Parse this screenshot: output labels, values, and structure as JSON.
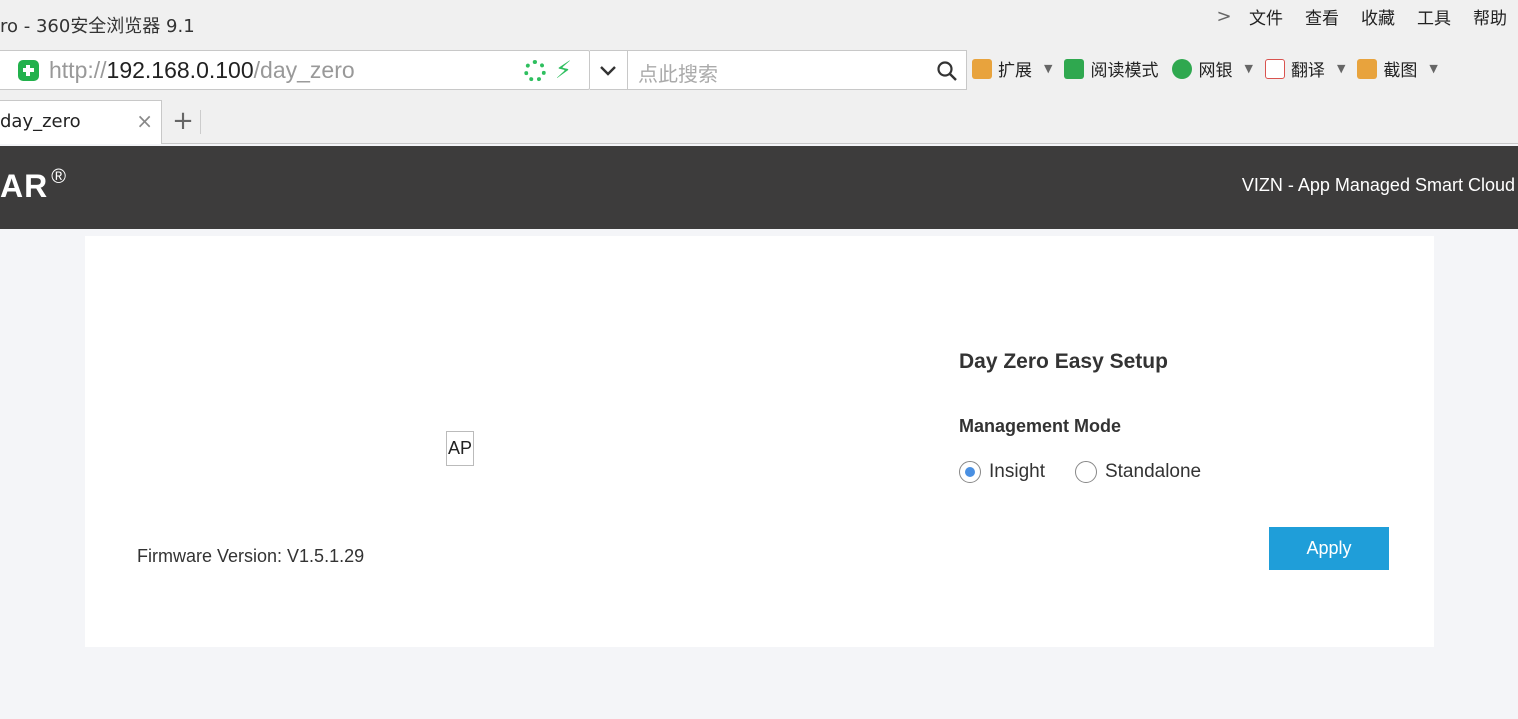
{
  "window": {
    "title": "ro - 360安全浏览器 9.1"
  },
  "menu": {
    "chevron": ">",
    "items": [
      "文件",
      "查看",
      "收藏",
      "工具",
      "帮助"
    ]
  },
  "address_bar": {
    "scheme": "http://",
    "host": "192.168.0.100",
    "path": "/day_zero"
  },
  "search": {
    "placeholder": "点此搜索"
  },
  "extensions": [
    {
      "label": "扩展",
      "icon": "extensions-icon",
      "color": "#e8a33d",
      "has_caret": true
    },
    {
      "label": "阅读模式",
      "icon": "reading-mode-icon",
      "color": "#2fa84f",
      "has_caret": false
    },
    {
      "label": "网银",
      "icon": "netbank-icon",
      "color": "#2fa84f",
      "has_caret": true
    },
    {
      "label": "翻译",
      "icon": "translate-icon",
      "color": "#d9534f",
      "has_caret": true
    },
    {
      "label": "截图",
      "icon": "screenshot-icon",
      "color": "#e8a33d",
      "has_caret": true
    }
  ],
  "tab": {
    "label": "day_zero",
    "close": "×",
    "new_tab": "+"
  },
  "header": {
    "brand": "AR",
    "brand_mark": "®",
    "tagline": "VIZN - App Managed Smart Cloud"
  },
  "card": {
    "device_label": "AP",
    "firmware": "Firmware Version: V1.5.1.29",
    "setup_title": "Day Zero Easy Setup",
    "mode_label": "Management Mode",
    "modes": [
      {
        "label": "Insight",
        "checked": true
      },
      {
        "label": "Standalone",
        "checked": false
      }
    ],
    "apply_label": "Apply"
  },
  "colors": {
    "header_bg": "#3d3c3c",
    "accent": "#1f9ed9",
    "radio_selected": "#4a90e2"
  }
}
